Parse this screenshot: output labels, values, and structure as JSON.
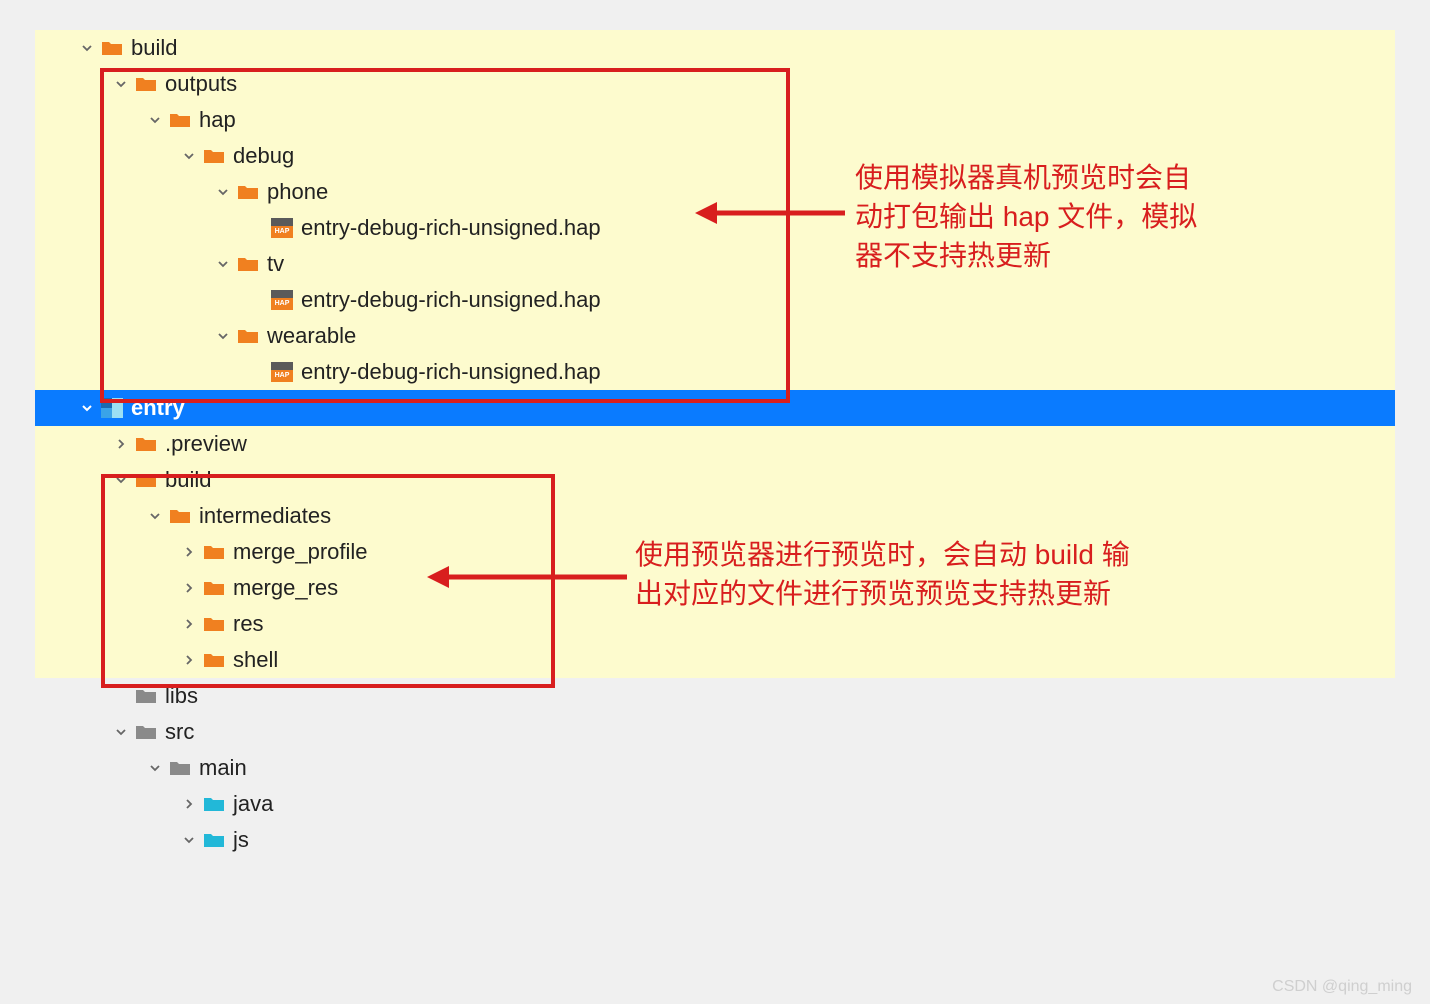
{
  "tree": {
    "build": "build",
    "outputs": "outputs",
    "hap": "hap",
    "debug": "debug",
    "phone": "phone",
    "hap_file": "entry-debug-rich-unsigned.hap",
    "tv": "tv",
    "wearable": "wearable",
    "entry": "entry",
    "preview": ".preview",
    "intermediates": "intermediates",
    "merge_profile": "merge_profile",
    "merge_res": "merge_res",
    "res": "res",
    "shell": "shell",
    "libs": "libs",
    "src": "src",
    "main": "main",
    "java": "java",
    "js": "js"
  },
  "annotations": {
    "top": "使用模拟器真机预览时会自动打包输出 hap 文件，模拟器不支持热更新",
    "bottom": "使用预览器进行预览时，会自动 build 输出对应的文件进行预览预览支持热更新"
  },
  "watermark": "CSDN @qing_ming"
}
